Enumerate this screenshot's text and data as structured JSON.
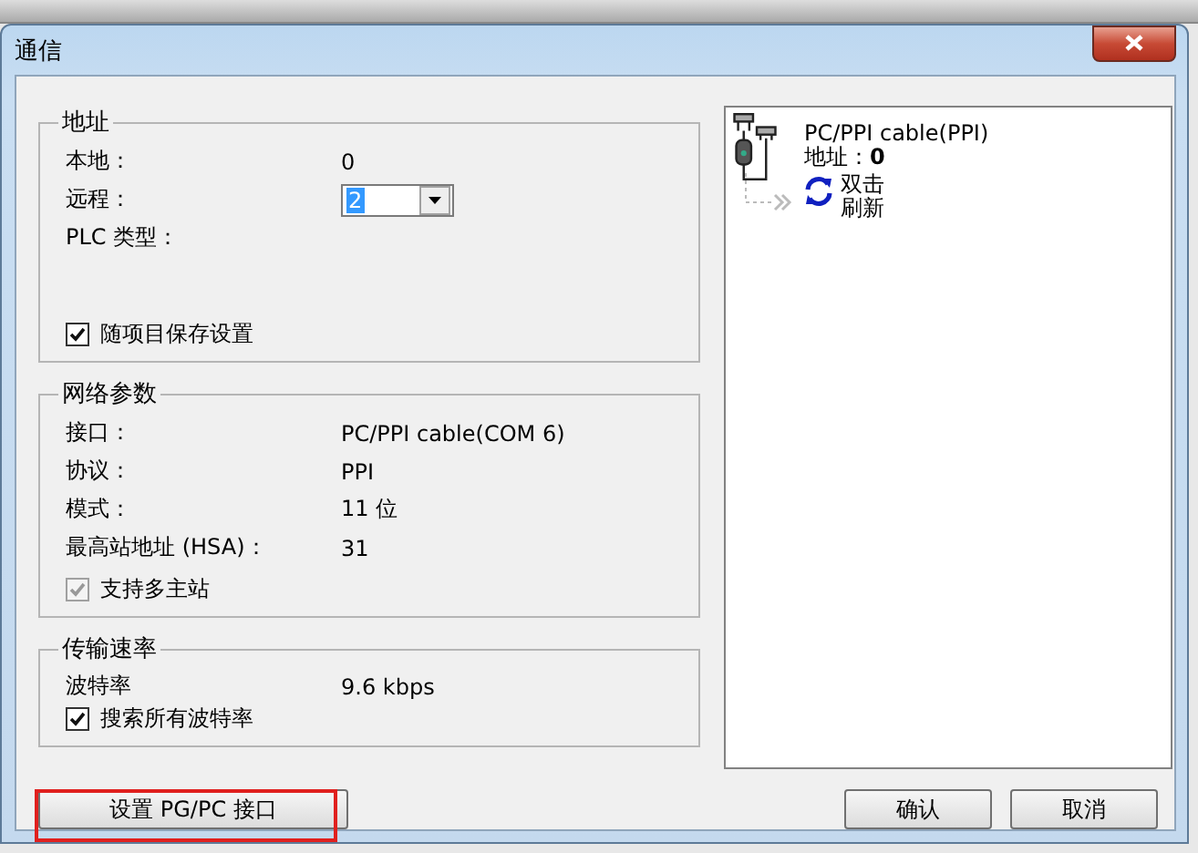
{
  "window": {
    "title": "通信"
  },
  "address_group": {
    "title": "地址",
    "rows": [
      {
        "kind": "text",
        "label": "本地：",
        "value": "0"
      },
      {
        "kind": "dropdown",
        "label": "远程：",
        "value": "2",
        "selected": true
      },
      {
        "kind": "text",
        "label": "PLC 类型：",
        "value": ""
      }
    ],
    "checkbox": {
      "label": "随项目保存设置",
      "checked": true,
      "disabled": false
    }
  },
  "network_group": {
    "title": "网络参数",
    "rows": [
      {
        "kind": "text",
        "label": "接口：",
        "value": "PC/PPI cable(COM 6)"
      },
      {
        "kind": "text",
        "label": "协议：",
        "value": "PPI"
      },
      {
        "kind": "text",
        "label": "模式：",
        "value": "11 位"
      },
      {
        "kind": "text",
        "label": "最高站地址 (HSA)：",
        "value": "31"
      }
    ],
    "checkbox": {
      "label": "支持多主站",
      "checked": true,
      "disabled": true
    }
  },
  "baud_group": {
    "title": "传输速率",
    "rows": [
      {
        "kind": "text",
        "label": "波特率",
        "value": "9.6 kbps"
      }
    ],
    "checkbox": {
      "label": "搜索所有波特率",
      "checked": true,
      "disabled": false
    }
  },
  "device_tree": {
    "device": {
      "name": "PC/PPI cable(PPI)",
      "address": "地址：**0**"
    },
    "child": {
      "label": "双击刷新"
    }
  },
  "buttons": [
    {
      "label": "设置 PG/PC 接口",
      "annotated": true
    },
    {
      "label": "确认",
      "annotated": false
    },
    {
      "label": "取消",
      "annotated": false
    }
  ]
}
